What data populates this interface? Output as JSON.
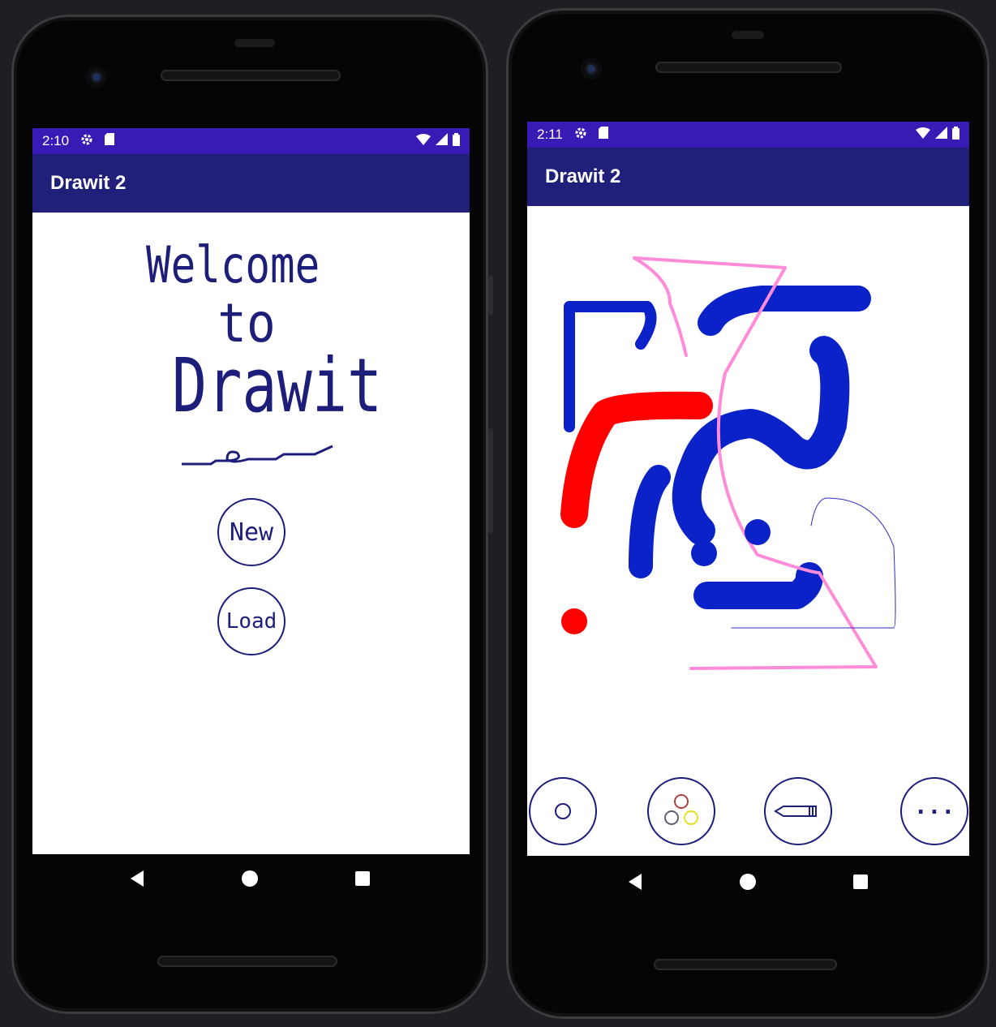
{
  "left_phone": {
    "status": {
      "time": "2:10"
    },
    "appbar": {
      "title": "Drawit 2"
    },
    "welcome": {
      "line1": "Welcome",
      "line2": "to",
      "line3": "Drawit"
    },
    "buttons": {
      "new_label": "New",
      "load_label": "Load"
    }
  },
  "right_phone": {
    "status": {
      "time": "2:11"
    },
    "appbar": {
      "title": "Drawit 2"
    },
    "toolbar": {
      "more_label": "···"
    }
  },
  "colors": {
    "status_bar": "#3a1ab5",
    "app_bar": "#20207a",
    "ink": "#1d1d7a"
  }
}
